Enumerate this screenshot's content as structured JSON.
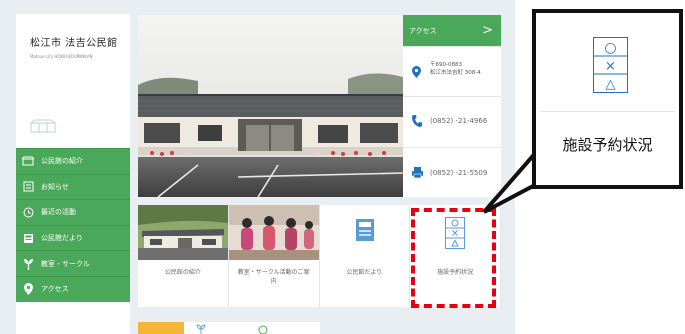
{
  "brand": {
    "title": "松江市 法吉公民館",
    "subtitle": "Matsue city HOKKI KOUMINKAN"
  },
  "nav": {
    "items": [
      {
        "label": "公民館の紹介",
        "icon": "building-icon"
      },
      {
        "label": "お知らせ",
        "icon": "notice-icon"
      },
      {
        "label": "最近の活動",
        "icon": "clock-icon"
      },
      {
        "label": "公民館だより",
        "icon": "newsletter-icon"
      },
      {
        "label": "教室・サークル",
        "icon": "sprout-icon"
      },
      {
        "label": "アクセス",
        "icon": "map-pin-icon"
      }
    ]
  },
  "access": {
    "heading": "アクセス",
    "chevron": ">",
    "postal": "〒690-0883",
    "address": "松江市法吉町 308-4",
    "tel": "(0852) -21-4966",
    "fax": "(0852) -21-5509"
  },
  "cards": [
    {
      "label": "公民館の紹介"
    },
    {
      "label": "教室・サークル活動のご案内"
    },
    {
      "label": "公民館だより"
    },
    {
      "label": "施設予約状況"
    }
  ],
  "callout": {
    "label": "施設予約状況",
    "symbols": [
      "○",
      "×",
      "△"
    ]
  },
  "colors": {
    "green": "#4aa85b",
    "highlight": "#e60012",
    "icon_blue": "#1e73be"
  }
}
